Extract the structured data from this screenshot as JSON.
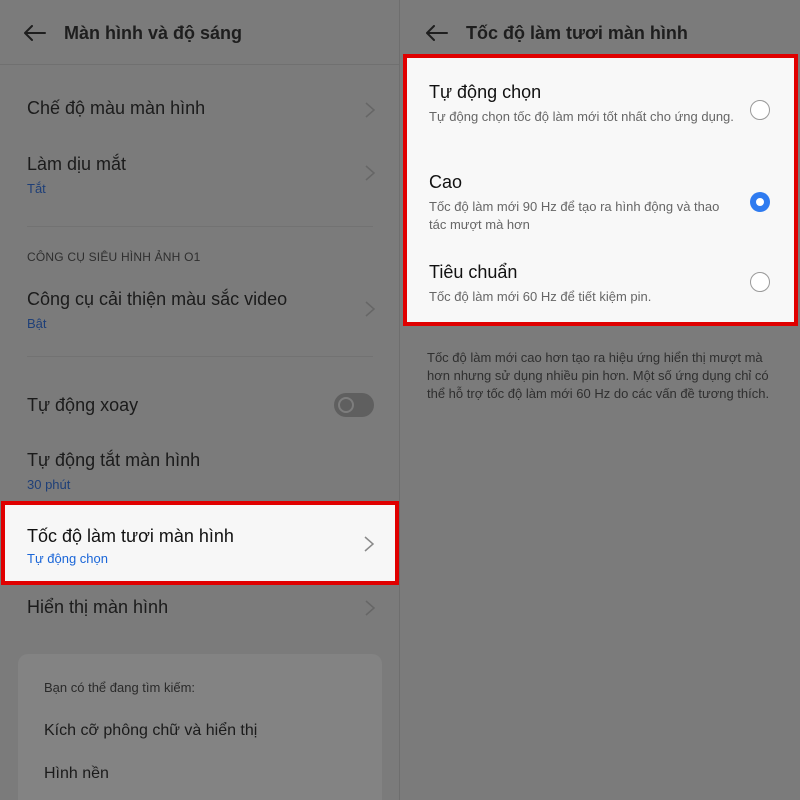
{
  "left": {
    "title": "Màn hình và độ sáng",
    "items": [
      {
        "label": "Chế độ màu màn hình"
      },
      {
        "label": "Làm dịu mắt",
        "sub": "Tắt"
      },
      {
        "label": "Công cụ cải thiện màu sắc video",
        "sub": "Bật"
      },
      {
        "label": "Tự động xoay"
      },
      {
        "label": "Tự động tắt màn hình",
        "sub": "30 phút"
      },
      {
        "label": "Tốc độ làm tươi màn hình",
        "sub": "Tự động chọn"
      },
      {
        "label": "Hiển thị màn hình"
      }
    ],
    "section_header": "CÔNG CỤ SIÊU HÌNH ẢNH O1",
    "auto_rotate_enabled": false,
    "search_card": {
      "hint": "Bạn có thể đang tìm kiếm:",
      "items": [
        "Kích cỡ phông chữ và hiển thị",
        "Hình nền"
      ]
    }
  },
  "right": {
    "title": "Tốc độ làm tươi màn hình",
    "options": [
      {
        "label": "Tự động chọn",
        "desc": "Tự động chọn tốc độ làm mới tốt nhất cho ứng dụng.",
        "selected": false
      },
      {
        "label": "Cao",
        "desc": "Tốc độ làm mới 90 Hz để tạo ra hình động và thao tác mượt mà hơn",
        "selected": true
      },
      {
        "label": "Tiêu chuẩn",
        "desc": "Tốc độ làm mới 60 Hz để tiết kiệm pin.",
        "selected": false
      }
    ],
    "footnote": "Tốc độ làm mới cao hơn tạo ra hiệu ứng hiển thị mượt mà hơn nhưng sử dụng nhiều pin hơn. Một số ứng dụng chỉ có thể hỗ trợ tốc độ làm mới 60 Hz do các vấn đề tương thích."
  },
  "colors": {
    "highlight_border": "#e00000",
    "accent_blue": "#2f7bf0",
    "dimmed_background": "#7b7b7b"
  }
}
